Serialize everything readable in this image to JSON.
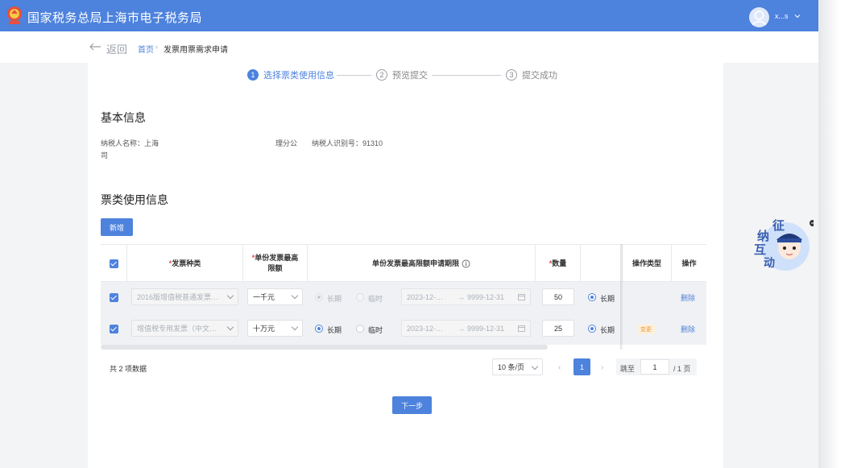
{
  "header": {
    "title": "国家税务总局上海市电子税务局",
    "user_name": "x...s"
  },
  "breadcrumb": {
    "back_label": "返回",
    "home": "首页",
    "separator": "›",
    "current": "发票用票需求申请"
  },
  "steps": [
    {
      "number": "1",
      "label": "选择票类使用信息",
      "state": "active"
    },
    {
      "number": "2",
      "label": "预览提交",
      "state": "todo"
    },
    {
      "number": "3",
      "label": "提交成功",
      "state": "todo"
    }
  ],
  "basic_info": {
    "title": "基本信息",
    "taxpayer_name_label": "纳税人名称：上海",
    "taxpayer_name_tail": "理分公",
    "taxpayer_name_wrap": "司",
    "taxpayer_id_label": "纳税人识别号：91310"
  },
  "ticket_info": {
    "title": "票类使用信息",
    "add_button": "新增",
    "required_mark": "*",
    "columns": {
      "type": "发票种类",
      "max_amount_line1": "单份发票最高",
      "max_amount_line2": "限额",
      "period": "单份发票最高限额申请期限",
      "quantity": "数量",
      "op_type": "操作类型",
      "action": "操作"
    },
    "rows": [
      {
        "type": "2016版增值税普通发票…",
        "max_amount": "一千元",
        "period_long": "长期",
        "period_temp": "临时",
        "date_start": "2023-12-…",
        "date_arrow": "→",
        "date_end": "9999-12-31",
        "quantity": "50",
        "qty_long": "长期",
        "op_type": "",
        "action": "删除"
      },
      {
        "type": "增值税专用发票（中文…",
        "max_amount": "十万元",
        "period_long": "长期",
        "period_temp": "临时",
        "date_start": "2023-12-…",
        "date_arrow": "→",
        "date_end": "9999-12-31",
        "quantity": "25",
        "qty_long": "长期",
        "op_type": "变更",
        "action": "删除"
      }
    ]
  },
  "pagination": {
    "total": "共 2 项数据",
    "page_size": "10 条/页",
    "prev": "‹",
    "current": "1",
    "next": "›",
    "jump_label": "跳至",
    "jump_value": "1",
    "total_pages": "/ 1 页"
  },
  "next_button": "下一步",
  "mascot": {
    "line1": "征",
    "line2": "纳",
    "line3": "互",
    "line4": "动"
  },
  "colors": {
    "primary": "#4d82dd",
    "required": "#e5484d",
    "tag": "#e89a3c"
  }
}
